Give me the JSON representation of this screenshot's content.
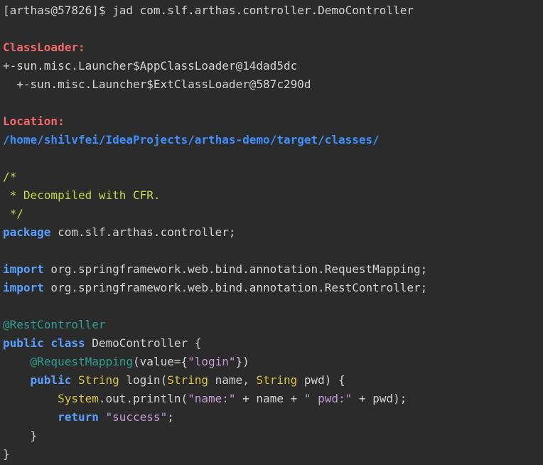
{
  "terminal": {
    "prompt": "[arthas@57826]$ ",
    "command": "jad com.slf.arthas.controller.DemoController",
    "classloader_label": "ClassLoader:",
    "classloader_lines": [
      "+-sun.misc.Launcher$AppClassLoader@14dad5dc",
      "  +-sun.misc.Launcher$ExtClassLoader@587c290d"
    ],
    "location_label": "Location:",
    "location_path": "/home/shilvfei/IdeaProjects/arthas-demo/target/classes/"
  },
  "source": {
    "comment_open": "/*",
    "comment_body": " * Decompiled with CFR.",
    "comment_close": " */",
    "kw_package": "package",
    "package_name": " com.slf.arthas.controller;",
    "kw_import": "import",
    "imports": [
      " org.springframework.web.bind.annotation.RequestMapping;",
      " org.springframework.web.bind.annotation.RestController;"
    ],
    "class_annotation": "@RestController",
    "kw_public": "public",
    "kw_class": "class",
    "class_rest": " DemoController {",
    "indent1": "    ",
    "indent2": "        ",
    "method_annotation": "@RequestMapping",
    "method_annotation_rest_a": "(value={",
    "method_annotation_string": "\"login\"",
    "method_annotation_rest_b": "})",
    "method_name": " login(",
    "type_string": "String",
    "param1": " name, ",
    "param2": " pwd) {",
    "system": "System",
    "println_call": ".out.println(",
    "str_name": "\"name:\"",
    "concat1": " + name + ",
    "str_pwd": "\" pwd:\"",
    "concat2": " + pwd);",
    "kw_return": "return",
    "str_success": "\"success\"",
    "semicolon": ";",
    "close_method": "    }",
    "close_class": "}"
  },
  "colors": {
    "background": "#2b2b2b",
    "text": "#d4d4d4",
    "label": "#f26b6b",
    "path": "#3c8fff",
    "comment": "#c3d94b",
    "keyword": "#5aa0ff",
    "annotation": "#2f9e94",
    "type": "#d8c34a",
    "string": "#c99bd6"
  }
}
